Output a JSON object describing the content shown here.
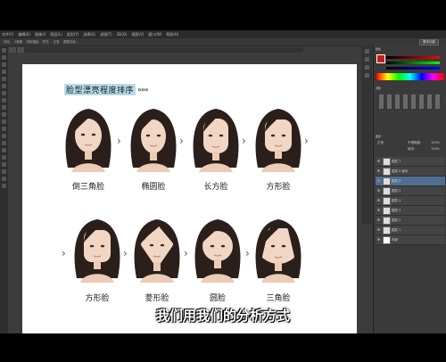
{
  "app": {
    "menu": [
      "文件(F)",
      "编辑(E)",
      "图像(I)",
      "图层(L)",
      "类型(Y)",
      "选择(S)",
      "滤镜(T)",
      "3D(D)",
      "视图(V)",
      "窗口(W)",
      "帮助(H)"
    ],
    "essentials_label": "基本功能"
  },
  "options": {
    "feather_label": "羽化:",
    "feather_value": "0像素",
    "antialias_label": "消除锯齿",
    "style_label": "样式:",
    "style_value": "正常",
    "refine_label": "调整边缘..."
  },
  "document": {
    "title": "脸型漂亮程度排序",
    "title_arrows": "»»»",
    "row1_labels": [
      "倒三角脸",
      "椭圆脸",
      "长方脸",
      "方形脸"
    ],
    "row2_labels": [
      "方形脸",
      "菱形脸",
      "圆脸",
      "三角脸"
    ]
  },
  "panels": {
    "color_tab": "颜色",
    "adjust_tab": "调整",
    "layers_tab": "图层",
    "blend_mode": "正常",
    "opacity_label": "不透明度:",
    "opacity_value": "100%",
    "fill_label": "填充:",
    "fill_value": "100%",
    "layers": [
      "图层 7",
      "图层 6 副本",
      "图层 6",
      "图层 5",
      "图层 4",
      "图层 3",
      "图层 2",
      "图层 1",
      "背景"
    ]
  },
  "caption": "我们用我们的分析方式",
  "colors": {
    "title_highlight": "#b7dcec",
    "layer_active": "#4f6f92",
    "canvas_bg": "#3c3c3c"
  }
}
